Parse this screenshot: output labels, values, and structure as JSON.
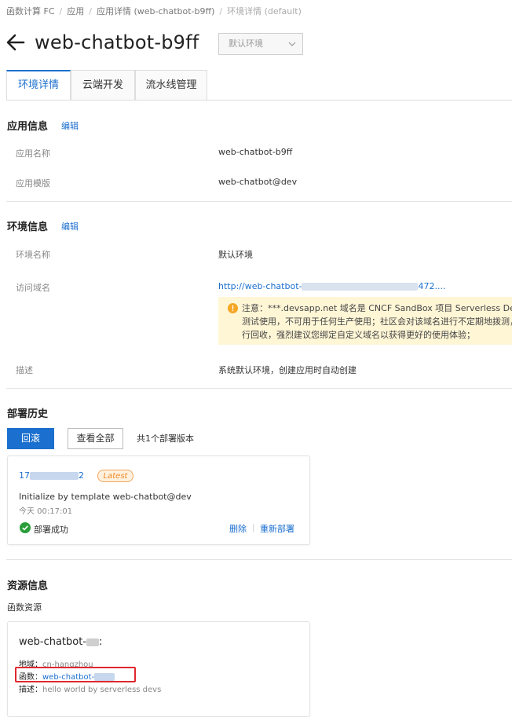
{
  "breadcrumb": [
    "函数计算 FC",
    "应用",
    "应用详情 (web-chatbot-b9ff)",
    "环境详情 (default)"
  ],
  "header": {
    "title": "web-chatbot-b9ff",
    "env_select": "默认环境"
  },
  "tabs": [
    "环境详情",
    "云端开发",
    "流水线管理"
  ],
  "app_info": {
    "title": "应用信息",
    "edit": "编辑",
    "name_label": "应用名称",
    "name_value": "web-chatbot-b9ff",
    "template_label": "应用模版",
    "template_value": "web-chatbot@dev"
  },
  "env_info": {
    "title": "环境信息",
    "edit": "编辑",
    "env_name_label": "环境名称",
    "env_name_value": "默认环境",
    "domain_label": "访问域名",
    "domain_prefix": "http://web-chatbot-",
    "domain_suffix": "472....",
    "notice_lines": [
      "注意：***.devsapp.net 域名是 CNCF SandBox 项目 Serverless Devs",
      "测试使用，不可用于任何生产使用；社区会对该域名进行不定期地拨测，",
      "行回收，强烈建议您绑定自定义域名以获得更好的使用体验；"
    ],
    "desc_label": "描述",
    "desc_value": "系统默认环境，创建应用时自动创建"
  },
  "deploy_history": {
    "title": "部署历史",
    "rollback": "回滚",
    "view_all": "查看全部",
    "count_text": "共1个部署版本",
    "card": {
      "version_prefix": "17",
      "version_suffix": "2",
      "badge": "Latest",
      "description": "Initialize by template web-chatbot@dev",
      "time": "今天 00:17:01",
      "status": "部署成功",
      "delete": "删除",
      "redeploy": "重新部署"
    }
  },
  "resources": {
    "title": "资源信息",
    "subtitle": "函数资源",
    "card": {
      "name_prefix": "web-chatbot-",
      "name_suffix": ":",
      "region_label": "地域：",
      "region_value": "cn-hangzhou",
      "function_label": "函数：",
      "function_value": "web-chatbot-",
      "desc_label": "描述：",
      "desc_value": "hello world by serverless devs"
    }
  },
  "colors": {
    "accent": "#1b6fce",
    "warning_bg": "#fff6d6",
    "success": "#2a9d3a",
    "badge": "#f08a24",
    "highlight": "#e0282e"
  }
}
